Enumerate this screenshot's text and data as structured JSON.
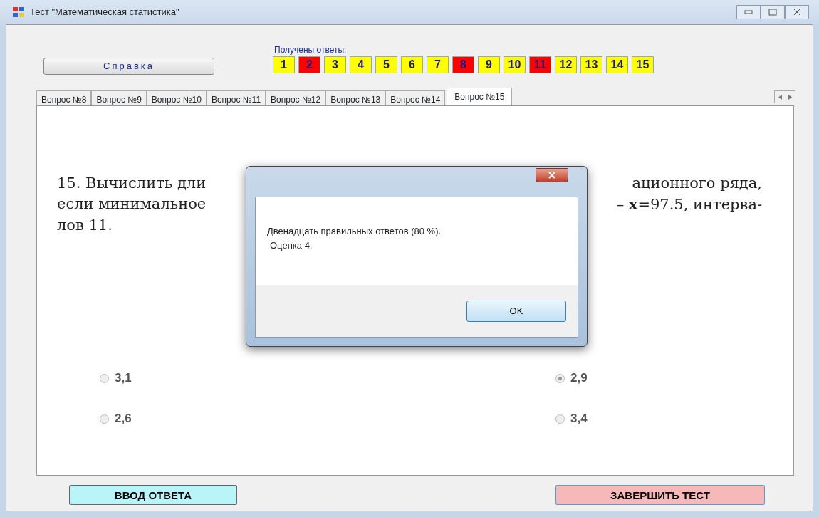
{
  "window": {
    "title": "Тест \"Математическая статистика\""
  },
  "help_button": "Справка",
  "answers": {
    "label": "Получены ответы:",
    "items": [
      {
        "label": "1",
        "color": "#ffff00"
      },
      {
        "label": "2",
        "color": "#ff0000"
      },
      {
        "label": "3",
        "color": "#ffff00"
      },
      {
        "label": "4",
        "color": "#ffff00"
      },
      {
        "label": "5",
        "color": "#ffff00"
      },
      {
        "label": "6",
        "color": "#ffff00"
      },
      {
        "label": "7",
        "color": "#ffff00"
      },
      {
        "label": "8",
        "color": "#ff0000"
      },
      {
        "label": "9",
        "color": "#ffff00"
      },
      {
        "label": "10",
        "color": "#ffff00"
      },
      {
        "label": "11",
        "color": "#ff0000"
      },
      {
        "label": "12",
        "color": "#ffff00"
      },
      {
        "label": "13",
        "color": "#ffff00"
      },
      {
        "label": "14",
        "color": "#ffff00"
      },
      {
        "label": "15",
        "color": "#ffff00"
      }
    ]
  },
  "tabs": [
    {
      "label": "Вопрос №8",
      "selected": false
    },
    {
      "label": "Вопрос №9",
      "selected": false
    },
    {
      "label": "Вопрос №10",
      "selected": false
    },
    {
      "label": "Вопрос №11",
      "selected": false
    },
    {
      "label": "Вопрос №12",
      "selected": false
    },
    {
      "label": "Вопрос №13",
      "selected": false
    },
    {
      "label": "Вопрос №14",
      "selected": false
    },
    {
      "label": "Вопрос №15",
      "selected": true
    }
  ],
  "question": {
    "lines": [
      {
        "left": "15. Вычислить дли",
        "right": "ационного ряда,"
      },
      {
        "left": "если минимальное",
        "right": "– **x**=97.5, интерва-"
      },
      {
        "left": "лов 11."
      }
    ]
  },
  "options": [
    {
      "label": "3,1",
      "selected": false
    },
    {
      "label": "2,9",
      "selected": true
    },
    {
      "label": "2,6",
      "selected": false
    },
    {
      "label": "3,4",
      "selected": false
    }
  ],
  "enter_button": "ВВОД ОТВЕТА",
  "finish_button": "ЗАВЕРШИТЬ ТЕСТ",
  "dialog": {
    "message": "Двенадцать правильных ответов (80 %).",
    "grade": "Оценка 4.",
    "ok": "OK"
  }
}
